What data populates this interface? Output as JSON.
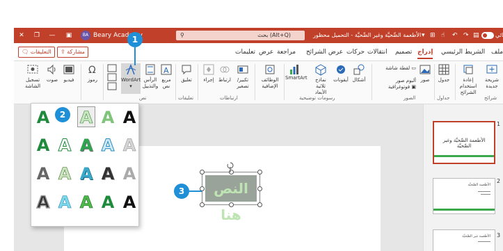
{
  "titlebar": {
    "account_name": "Beary Academy",
    "account_initials": "BA",
    "search_text": "بحث (Alt+Q)",
    "doc_title": "الأطعمة الصِّحيَّة وغير الصِّحيَّة - التحميل محظور",
    "autosave_label": "حفظ تلقائي"
  },
  "tabs": {
    "file": "ملف",
    "home": "الشريط الرئيسي",
    "insert": "إدراج",
    "design": "تصميم",
    "transitions": "انتقالات",
    "animations": "حركات",
    "slideshow": "عرض الشرائح",
    "review": "مراجعة",
    "view": "عرض",
    "help": "تعليمات",
    "share": "مشاركة",
    "comments": "التعليقات"
  },
  "ribbon": {
    "new_slide": "شريحة جديدة",
    "reuse_slides": "إعادة استخدام الشرائح",
    "slides_group": "شرائح",
    "table": "جدول",
    "tables_group": "جداول",
    "pictures": "صور",
    "screenshot": "لقطة شاشة",
    "photo_album": "ألبوم صور فوتوغرافية",
    "images_group": "الصور",
    "shapes": "أشكال",
    "icons": "أيقونات",
    "models_3d": "نماذج ثلاثية الأبعاد",
    "smartart": "SmartArt",
    "chart": "مخطط",
    "illustrations_group": "رسومات توضيحية",
    "addins": "الوظائف الإضافية",
    "zoom": "تكبير/تصغير",
    "link": "ارتباط",
    "action": "إجراء",
    "links_group": "ارتباطات",
    "comment": "تعليق",
    "comments_group": "تعليقات",
    "textbox": "مربع نص",
    "header_footer": "الرأس والتذييل",
    "wordart": "WordArt",
    "text_group": "نص",
    "symbols": "رموز",
    "video": "فيديو",
    "audio": "صوت",
    "screen_recording": "تسجيل الشاشة"
  },
  "gallery": {
    "letter": "A"
  },
  "slide": {
    "placeholder_text": "النص هنا"
  },
  "thumbnails": [
    {
      "number": "1",
      "title": "الأطعمة الصِّحيَّة وغير الصِّحيَّة"
    },
    {
      "number": "2",
      "title": "الأطعمة الصِّحيَّة"
    },
    {
      "number": "3",
      "title": "الأطعمة غير الصِّحيَّة"
    }
  ],
  "callouts": {
    "one": "1",
    "two": "2",
    "three": "3"
  },
  "colors": {
    "accent": "#c1402a",
    "callout": "#1f8fd8",
    "wordart_green": "#1e8a3c"
  }
}
